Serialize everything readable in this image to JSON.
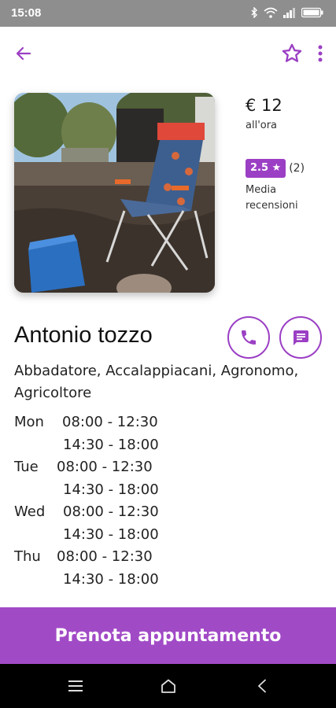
{
  "status_bar": {
    "time": "15:08",
    "icons": [
      "bluetooth-icon",
      "wifi-icon",
      "signal-icon",
      "battery-icon"
    ]
  },
  "app_bar": {
    "icons": [
      "arrow-back-icon",
      "star-outline-icon",
      "more-vert-icon"
    ]
  },
  "profile": {
    "price": "€ 12",
    "price_unit": "all'ora",
    "rating": "2.5 ★",
    "rating_count": "(2)",
    "rating_caption": "Media recensioni",
    "name": "Antonio tozzo",
    "categories": "Abbadatore, Accalappiacani, Agronomo, Agricoltore"
  },
  "schedule": [
    {
      "day": "Mon",
      "slots": [
        "08:00 - 12:30",
        "14:30 - 18:00"
      ]
    },
    {
      "day": "Tue",
      "slots": [
        "08:00 - 12:30",
        "14:30 - 18:00"
      ]
    },
    {
      "day": "Wed",
      "slots": [
        "08:00 - 12:30",
        "14:30 - 18:00"
      ]
    },
    {
      "day": "Thu",
      "slots": [
        "08:00 - 12:30",
        "14:30 - 18:00"
      ]
    }
  ],
  "actions": {
    "book_label": "Prenota appuntamento"
  },
  "colors": {
    "accent": "#9b3fc4",
    "button": "#a14ac6",
    "status_bar": "#8e8e8e",
    "nav_bar": "#000000"
  }
}
